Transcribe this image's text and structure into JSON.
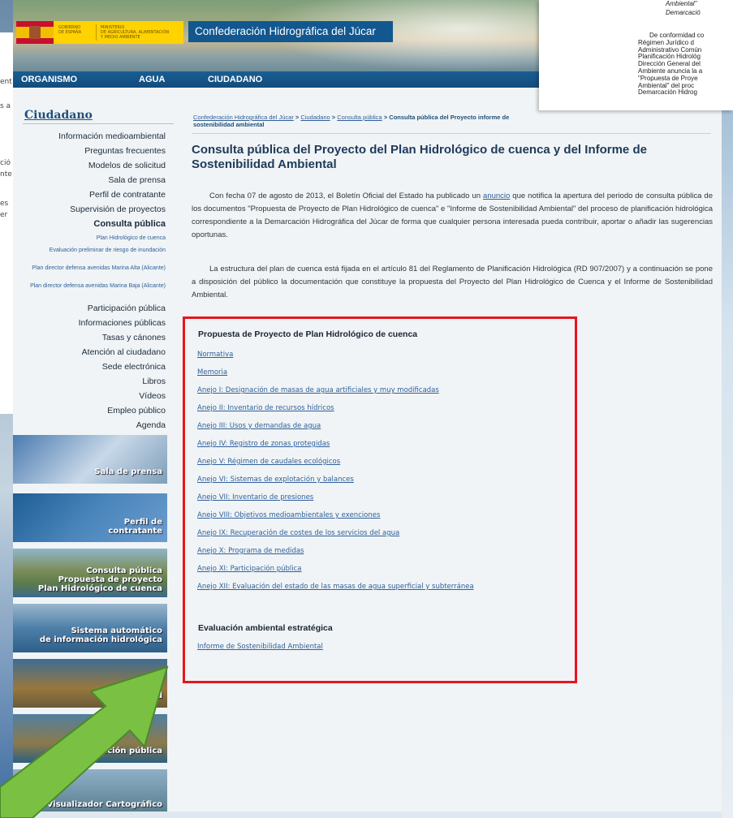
{
  "left_strip_text": [
    "ent",
    "s a",
    "ció",
    "nte",
    "es",
    "er"
  ],
  "header": {
    "gobierno": [
      "GOBIERNO",
      "DE ESPAÑA"
    ],
    "ministerio": [
      "MINISTERIO",
      "DE AGRICULTURA, ALIMENTACIÓN",
      "Y MEDIO AMBIENTE"
    ],
    "site_title": "Confederación Hidrográfica del Júcar"
  },
  "nav": {
    "items": [
      "ORGANISMO",
      "AGUA",
      "CIUDADANO"
    ]
  },
  "sidebar": {
    "title": "Ciudadano",
    "items": [
      "Información medioambiental",
      "Preguntas frecuentes",
      "Modelos de solicitud",
      "Sala de prensa",
      "Perfil de contratante",
      "Supervisión de proyectos",
      "Consulta pública"
    ],
    "sub_items": [
      "Plan Hidrológico de cuenca",
      "Evaluación preliminar de riesgo de inundación",
      "Plan director defensa avenidas Marina Alta (Alicante)",
      "Plan director defensa avenidas Marina Baja (Alicante)"
    ],
    "items_after": [
      "Participación pública",
      "Informaciones públicas",
      "Tasas y cánones",
      "Atención al ciudadano",
      "Sede electrónica",
      "Libros",
      "Vídeos",
      "Empleo público",
      "Agenda"
    ],
    "banners": [
      [
        "Sala de prensa"
      ],
      [
        "Perfil de",
        "contratante"
      ],
      [
        "Consulta pública",
        "Propuesta de proyecto",
        "Plan Hidrológico de cuenca"
      ],
      [
        "Sistema automático",
        "de información hidrológica"
      ],
      [
        "ud"
      ],
      [
        "ación pública"
      ],
      [
        "Visualizador Cartográfico"
      ]
    ]
  },
  "breadcrumb": {
    "link1": "Confederación Hidrográfica del Júcar",
    "sep": ">",
    "link2": "Ciudadano",
    "link3": "Consulta pública",
    "current": "Consulta pública del Proyecto informe de sostenibilidad ambiental"
  },
  "main": {
    "title": "Consulta pública del Proyecto del Plan Hidrológico de cuenca y del Informe de Sostenibilidad Ambiental",
    "para1_before": "Con fecha 07 de agosto de 2013, el Boletín Oficial del Estado ha publicado un ",
    "para1_link": "anuncio",
    "para1_after": " que notifica la apertura del periodo de consulta pública de los documentos \"Propuesta de Proyecto de Plan Hidrológico de cuenca\" e \"Informe de Sostenibilidad Ambiental\" del proceso de planificación hidrológica correspondiente a la Demarcación Hidrográfica del Júcar de forma que cualquier persona interesada pueda contribuir, aportar o añadir las sugerencias oportunas.",
    "para2": "La estructura del plan de cuenca está fijada en el artículo 81 del Reglamento de Planificación Hidrológica (RD 907/2007) y a continuación se pone a disposición del público la documentación que constituye la propuesta del Proyecto del Plan Hidrológico de Cuenca y el Informe de Sostenibilidad Ambiental.",
    "section1_title": "Propuesta de Proyecto de Plan Hidrológico de cuenca",
    "section1_links": [
      "Normativa",
      "Memoria",
      "Anejo I: Designación de masas de agua artificiales y muy modificadas",
      "Anejo II: Inventario de recursos hídricos",
      "Anejo III: Usos y demandas de agua",
      "Anejo IV: Registro de zonas protegidas",
      "Anejo V: Régimen de caudales ecológicos",
      "Anejo VI: Sistemas de explotación y balances",
      "Anejo VII: Inventario de presiones",
      "Anejo VIII: Objetivos medioambientales y exenciones",
      "Anejo IX: Recuperación de costes de los servicios del agua",
      "Anejo X: Programa de medidas",
      "Anejo XI: Participación pública",
      "Anejo XII: Evaluación del estado de las masas de agua superficial y subterránea"
    ],
    "section2_title": "Evaluación ambiental estratégica",
    "section2_links": [
      "Informe de Sostenibilidad Ambiental"
    ]
  },
  "doc_overlay": {
    "italic_lines": [
      "Ambiental\"",
      "Demarcació"
    ],
    "lines": [
      "De conformidad co",
      "Régimen Jurídico d",
      "Administrativo Común",
      "Planificación Hidrológ",
      "Dirección General del",
      "Ambiente anuncia la a",
      "\"Propuesta de Proye",
      "Ambiental\" del proc",
      "Demarcación Hidrog"
    ]
  },
  "colors": {
    "highlight_box": "#e8141e",
    "arrow": "#7ac143",
    "nav_bar": "#124c7c",
    "link": "#2f5f99"
  }
}
